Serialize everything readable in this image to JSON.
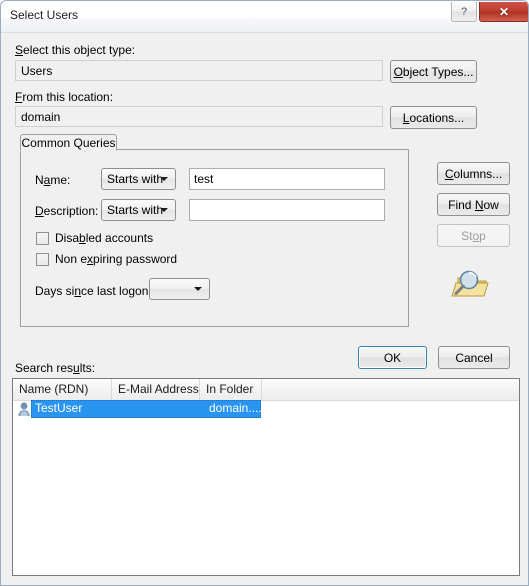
{
  "window": {
    "title": "Select Users",
    "help_button": "?",
    "close_button": "✕"
  },
  "object_type": {
    "label_pre": "S",
    "label_rest": "elect this object type:",
    "value": "Users",
    "button": "Object Types..."
  },
  "location": {
    "label_pre": "F",
    "label_rest": "rom this location:",
    "value": "domain",
    "button": "Locations..."
  },
  "tab": {
    "label": "Common Queries"
  },
  "query": {
    "name_label_a": "N",
    "name_label_b": "a",
    "name_label_c": "me:",
    "name_condition": "Starts with",
    "name_value": "test",
    "desc_label_a": "D",
    "desc_label_b": "escription:",
    "desc_condition": "Starts with",
    "desc_value": "",
    "disabled_accounts_a": "Disa",
    "disabled_accounts_b": "b",
    "disabled_accounts_c": "led accounts",
    "non_expiring_a": "Non e",
    "non_expiring_b": "x",
    "non_expiring_c": "piring password",
    "days_label_a": "Days si",
    "days_label_b": "n",
    "days_label_c": "ce last logon:",
    "days_value": ""
  },
  "side_buttons": {
    "columns_a": "C",
    "columns_b": "olumns...",
    "find_now_a": "Find ",
    "find_now_b": "N",
    "find_now_c": "ow",
    "stop_a": "St",
    "stop_b": "o",
    "stop_c": "p",
    "search_icon": "magnifier-folder-icon"
  },
  "dialog_buttons": {
    "ok": "OK",
    "cancel": "Cancel"
  },
  "results": {
    "label_a": "Search res",
    "label_b": "u",
    "label_c": "lts:",
    "columns": [
      "Name (RDN)",
      "E-Mail Address",
      "In Folder"
    ],
    "rows": [
      {
        "name": "TestUser",
        "email": "",
        "in_folder": "domain...."
      }
    ]
  },
  "colors": {
    "selection": "#2a95f0",
    "close_button": "#bf3c30",
    "dialog_background": "#f0f0f0",
    "default_button_border": "#3c7fb1"
  }
}
